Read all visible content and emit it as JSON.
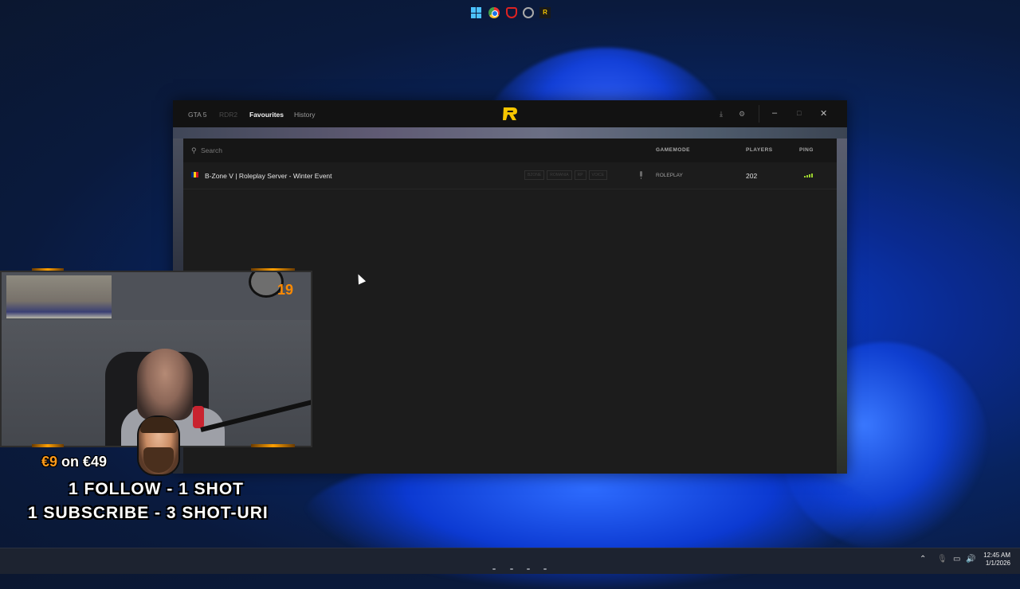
{
  "window": {
    "tabs": [
      {
        "label": "GTA 5"
      },
      {
        "label": "RDR2"
      },
      {
        "label": "Favourites"
      },
      {
        "label": "History"
      }
    ],
    "controls": {
      "minimize": "–",
      "maximize": "□",
      "close": "✕"
    }
  },
  "search": {
    "placeholder": "Search"
  },
  "columns": {
    "gamemode": "GAMEMODE",
    "players": "PLAYERS",
    "ping": "PING"
  },
  "servers": [
    {
      "name": "B-Zone V | Roleplay Server - Winter Event",
      "flag_colors": [
        "#002b7f",
        "#fcd116",
        "#ce1126"
      ],
      "tags": [
        "BZONE",
        "ROMANIA",
        "RP",
        "VOICE"
      ],
      "gamemode": "ROLEPLAY",
      "players": "202",
      "ping_bars": 4
    }
  ],
  "overlay": {
    "counter": "19",
    "promo_price": "€9",
    "promo_on": "on €49",
    "promo_line2": "1 FOLLOW - 1 SHOT",
    "promo_line3": "1 SUBSCRIBE - 3 SHOT-URI"
  },
  "taskbar": {
    "icons": [
      "start-icon",
      "chrome-icon",
      "shield-app-icon",
      "settings-app-icon",
      "redm-app-icon"
    ],
    "app_icon_letter": "R",
    "time": "12:45 AM",
    "date": "1/1/2026"
  },
  "colors": {
    "accent": "#f6c500",
    "ping": "#9bd22e",
    "promo": "#ff9a1a"
  }
}
